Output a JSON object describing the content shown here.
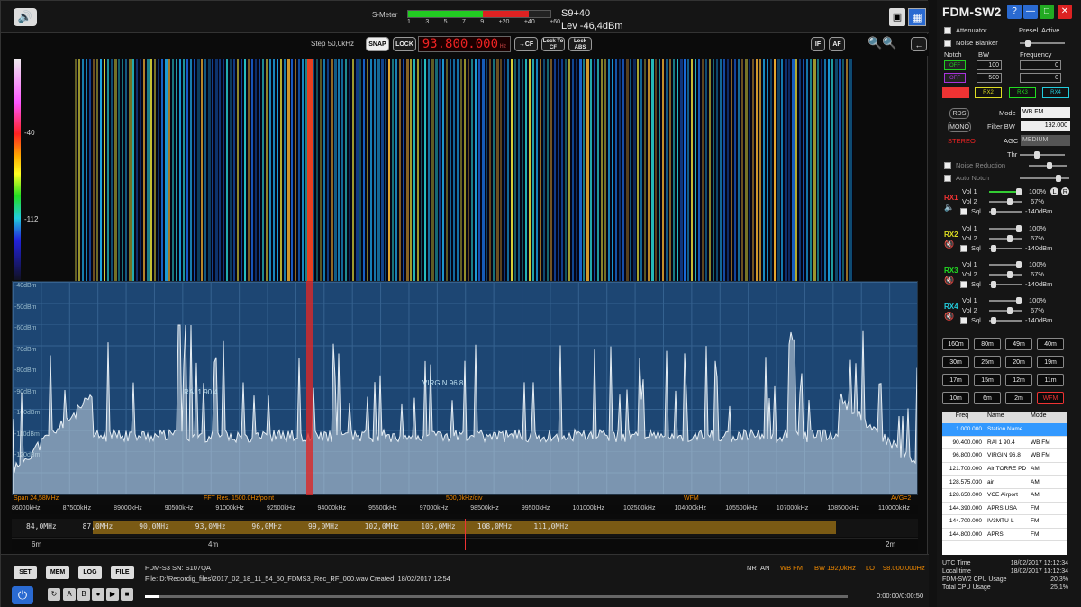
{
  "topbar": {
    "smeter_label": "S-Meter",
    "smeter_scale": [
      "1",
      "3",
      "5",
      "7",
      "9",
      "+20",
      "+40",
      "+60"
    ],
    "smeter_fill_fraction": 0.85,
    "s_value": "S9+40",
    "level": "Lev -46,4dBm"
  },
  "tuner": {
    "step": "Step 50,0kHz",
    "snap": "SNAP",
    "lock": "LOCK",
    "frequency": "93.800.000",
    "freq_unit": "Hz",
    "to_cf": "→CF",
    "lock_to_cf": "Lock To CF",
    "lock_abs": "Lock ABS",
    "if": "IF",
    "af": "AF"
  },
  "colorbar": {
    "high": "-40",
    "low": "-112"
  },
  "spectrum": {
    "db_labels": [
      "-40dBm",
      "-50dBm",
      "-60dBm",
      "-70dBm",
      "-80dBm",
      "-90dBm",
      "-100dBm",
      "-110dBm",
      "-120dBm"
    ],
    "station_tags": [
      {
        "label": "RAI 1 90.4"
      },
      {
        "label": "VIRGIN 96.8"
      }
    ],
    "span": "Span 24,58MHz",
    "fft_res": "FFT Res. 1500.0Hz/point",
    "div": "500,0kHz/div",
    "mode": "WFM",
    "avg": "AVG=2"
  },
  "freqscale": [
    "86000kHz",
    "87500kHz",
    "89000kHz",
    "90500kHz",
    "91000kHz",
    "92500kHz",
    "94000kHz",
    "95500kHz",
    "97000kHz",
    "98500kHz",
    "99500kHz",
    "101000kHz",
    "102500kHz",
    "104000kHz",
    "105500kHz",
    "107000kHz",
    "108500kHz",
    "110000kHz"
  ],
  "bandbar": [
    "84,0MHz",
    "87,0MHz",
    "90,0MHz",
    "93,0MHz",
    "96,0MHz",
    "99,0MHz",
    "102,0MHz",
    "105,0MHz",
    "108,0MHz",
    "111,0MHz"
  ],
  "meterbar": [
    "6m",
    "4m",
    "2m"
  ],
  "bottom": {
    "buttons": [
      "SET",
      "MEM",
      "LOG",
      "FILE"
    ],
    "device": "FDM-S3 SN: S107QA",
    "file": "File: D:\\Recordig_files\\2017_02_18_11_54_50_FDMS3_Rec_RF_000.wav Created: 18/02/2017 12:54",
    "status_nr": "NR",
    "status_an": "AN",
    "status_mode": "WB FM",
    "status_bw": "BW 192,0kHz",
    "status_lo": "LO",
    "status_lo_val": "98.000.000Hz",
    "time": "0:00:00/0:00:50",
    "play_labels": [
      "A",
      "B",
      "●",
      "▶",
      "■"
    ],
    "progress_fraction": 0.02
  },
  "side": {
    "title": "FDM-SW2",
    "attenuator": "Attenuator",
    "presel": "Presel. Active",
    "noise_blanker": "Noise Blanker",
    "notch": "Notch",
    "bw": "BW",
    "frequency": "Frequency",
    "off1": "OFF",
    "off2": "OFF",
    "bw1": "100",
    "bw2": "500",
    "f1": "0",
    "f2": "0",
    "rx_buttons": [
      "RX1",
      "RX2",
      "RX3",
      "RX4"
    ],
    "rds": "RDS",
    "mono": "MONO",
    "stereo": "STEREO",
    "mode_label": "Mode",
    "mode_value": "WB FM",
    "filter_bw_label": "Filter BW",
    "filter_bw_value": "192.000",
    "agc_label": "AGC",
    "agc_value": "MEDIUM",
    "thr": "Thr",
    "noise_reduction": "Noise Reduction",
    "auto_notch": "Auto Notch",
    "rx": [
      {
        "name": "RX1",
        "vol1": "100%",
        "vol2": "67%",
        "sql": "-140dBm",
        "color": "#e33"
      },
      {
        "name": "RX2",
        "vol1": "100%",
        "vol2": "67%",
        "sql": "-140dBm",
        "color": "#dd2"
      },
      {
        "name": "RX3",
        "vol1": "100%",
        "vol2": "67%",
        "sql": "-140dBm",
        "color": "#2d2"
      },
      {
        "name": "RX4",
        "vol1": "100%",
        "vol2": "67%",
        "sql": "-140dBm",
        "color": "#2cd"
      }
    ],
    "vol1_label": "Vol 1",
    "vol2_label": "Vol 2",
    "sql_label": "Sql",
    "lr_l": "L",
    "lr_r": "R",
    "bands": [
      "160m",
      "80m",
      "49m",
      "40m",
      "30m",
      "25m",
      "20m",
      "19m",
      "17m",
      "15m",
      "12m",
      "11m",
      "10m",
      "6m",
      "2m",
      "WFM"
    ],
    "mem_headers": [
      "Freq",
      "Name",
      "Mode"
    ],
    "mem_rows": [
      {
        "freq": "1.000.000",
        "name": "Station Name",
        "mode": ""
      },
      {
        "freq": "90.400.000",
        "name": "RAI 1 90.4",
        "mode": "WB FM"
      },
      {
        "freq": "96.800.000",
        "name": "VIRGIN 96.8",
        "mode": "WB FM"
      },
      {
        "freq": "121.700.000",
        "name": "Air TORRE PD",
        "mode": "AM"
      },
      {
        "freq": "128.575.030",
        "name": "air",
        "mode": "AM"
      },
      {
        "freq": "128.650.000",
        "name": "VCE Airport",
        "mode": "AM"
      },
      {
        "freq": "144.390.000",
        "name": "APRS USA",
        "mode": "FM"
      },
      {
        "freq": "144.700.000",
        "name": "IV3MTU-L",
        "mode": "FM"
      },
      {
        "freq": "144.800.000",
        "name": "APRS",
        "mode": "FM"
      }
    ],
    "stats": [
      {
        "label": "UTC Time",
        "value": "18/02/2017 12:12:34"
      },
      {
        "label": "Local time",
        "value": "18/02/2017 13:12:34"
      },
      {
        "label": "FDM-SW2 CPU Usage",
        "value": "20,3%"
      },
      {
        "label": "Total CPU Usage",
        "value": "25,1%"
      }
    ]
  }
}
